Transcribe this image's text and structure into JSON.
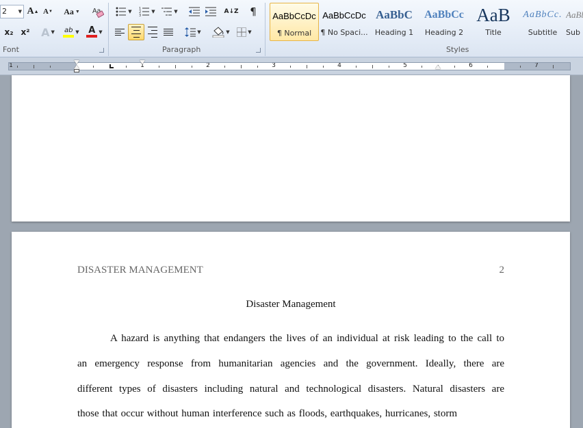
{
  "ribbon": {
    "font_group": {
      "label": "Font",
      "font_size": "2",
      "grow_font_label": "A",
      "shrink_font_label": "A",
      "change_case_label": "Aa",
      "subscript_label": "x₂",
      "superscript_label": "x²",
      "text_effects_label": "A",
      "highlight_label": "ab",
      "font_color_label": "A",
      "highlight_color": "#ffff00",
      "font_color": "#e02020"
    },
    "paragraph_group": {
      "label": "Paragraph",
      "sort_label": "A↓Z",
      "pilcrow_label": "¶"
    },
    "styles_group": {
      "label": "Styles",
      "tiles": [
        {
          "sample": "AaBbCcDc",
          "name": "¶ Normal",
          "color": "#111111"
        },
        {
          "sample": "AaBbCcDc",
          "name": "¶ No Spaci...",
          "color": "#111111"
        },
        {
          "sample": "AaBbC",
          "name": "Heading 1",
          "color": "#365f91"
        },
        {
          "sample": "AaBbCc",
          "name": "Heading 2",
          "color": "#4f81bd"
        },
        {
          "sample": "AaB",
          "name": "Title",
          "color": "#17365d"
        },
        {
          "sample": "AaBbCc.",
          "name": "Subtitle",
          "color": "#4f81bd"
        },
        {
          "sample": "AaBb",
          "name": "Sub",
          "color": "#808080"
        }
      ]
    }
  },
  "ruler": {
    "numbers": [
      "1",
      "1",
      "2",
      "3",
      "4",
      "5",
      "6",
      "7"
    ]
  },
  "page2": {
    "running_head": "DISASTER MANAGEMENT",
    "page_number": "2",
    "title": "Disaster Management",
    "lines": [
      "A hazard is anything that endangers the lives of an individual at risk leading to the call to",
      "an emergency response from humanitarian agencies and the government. Ideally, there are",
      "different types of disasters including natural and technological disasters. Natural disasters are",
      "those that occur without human interference such as floods, earthquakes, hurricanes, storm"
    ]
  },
  "colors": {
    "ribbon_bg": "#dfe8f5",
    "workspace_bg": "#9da6b1",
    "active_style_highlight": "#ffe8a6"
  }
}
